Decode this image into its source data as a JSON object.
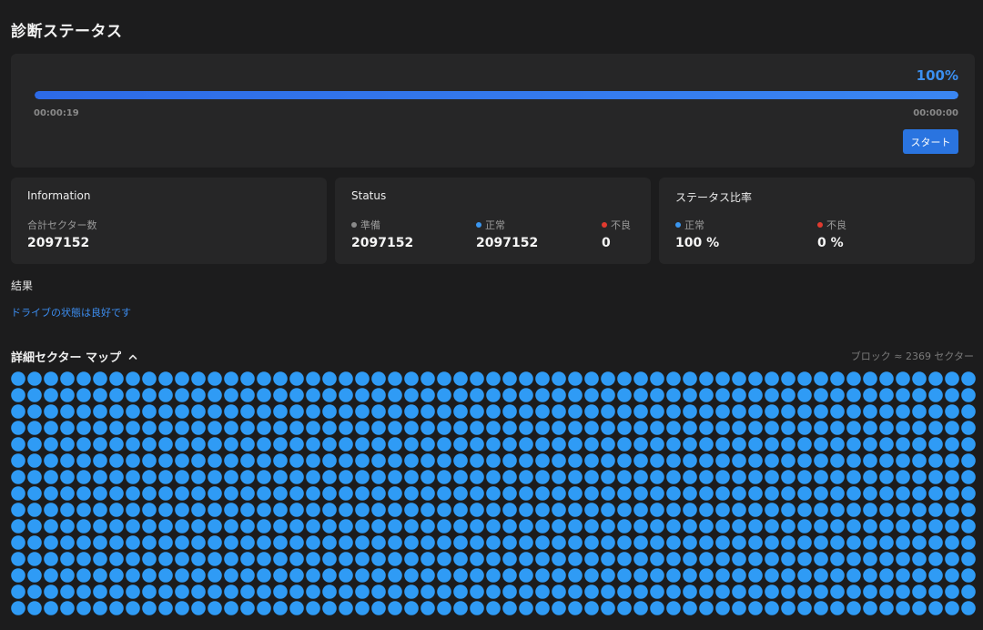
{
  "page": {
    "title": "診断ステータス"
  },
  "progress": {
    "percent_label": "100%",
    "percent_value": 1.0,
    "elapsed": "00:00:19",
    "remaining": "00:00:00",
    "start_label": "スタート",
    "fill_color": "#3a86f2"
  },
  "information": {
    "title": "Information",
    "total_label": "合計セクター数",
    "total_value": "2097152"
  },
  "status": {
    "title": "Status",
    "items": [
      {
        "label": "準備",
        "value": "2097152",
        "color": "#8a8a8a"
      },
      {
        "label": "正常",
        "value": "2097152",
        "color": "#3a96f0"
      },
      {
        "label": "不良",
        "value": "0",
        "color": "#e03a2f"
      }
    ]
  },
  "ratio": {
    "title": "ステータス比率",
    "items": [
      {
        "label": "正常",
        "value": "100 %",
        "color": "#3a96f0"
      },
      {
        "label": "不良",
        "value": "0 %",
        "color": "#e03a2f"
      }
    ]
  },
  "result": {
    "label": "結果",
    "message": "ドライブの状態は良好です"
  },
  "sector_map": {
    "title": "詳細セクター マップ",
    "note": "ブロック ≈ 2369 セクター",
    "columns": 59,
    "rows": 15,
    "cell_color": "#2f9bf5",
    "bad_blocks": 0
  }
}
